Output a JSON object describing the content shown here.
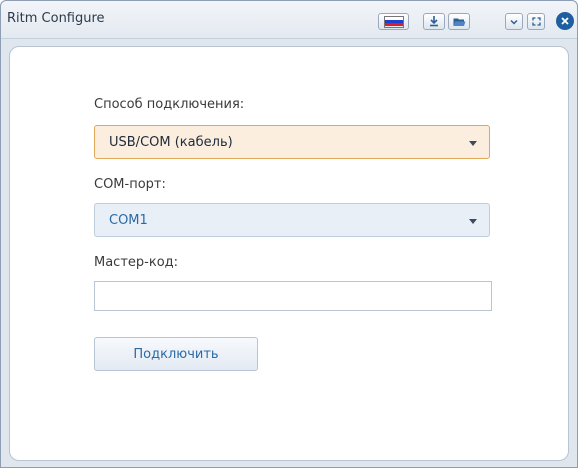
{
  "window": {
    "title": "Ritm Configure"
  },
  "titlebar_icons": [
    "flag-ru-icon",
    "download-icon",
    "folder-icon",
    "chevron-down-icon",
    "expand-icon",
    "close-icon"
  ],
  "form": {
    "connection_label": "Способ подключения:",
    "connection_value": "USB/COM (кабель)",
    "port_label": "COM-порт:",
    "port_value": "COM1",
    "master_code_label": "Мастер-код:",
    "master_code_value": "",
    "connect_button": "Подключить"
  },
  "colors": {
    "accent": "#2a6aa6",
    "focused_select_bg": "#fbeede",
    "focused_select_border": "#e0a95a",
    "close_button": "#1f5fa0"
  }
}
